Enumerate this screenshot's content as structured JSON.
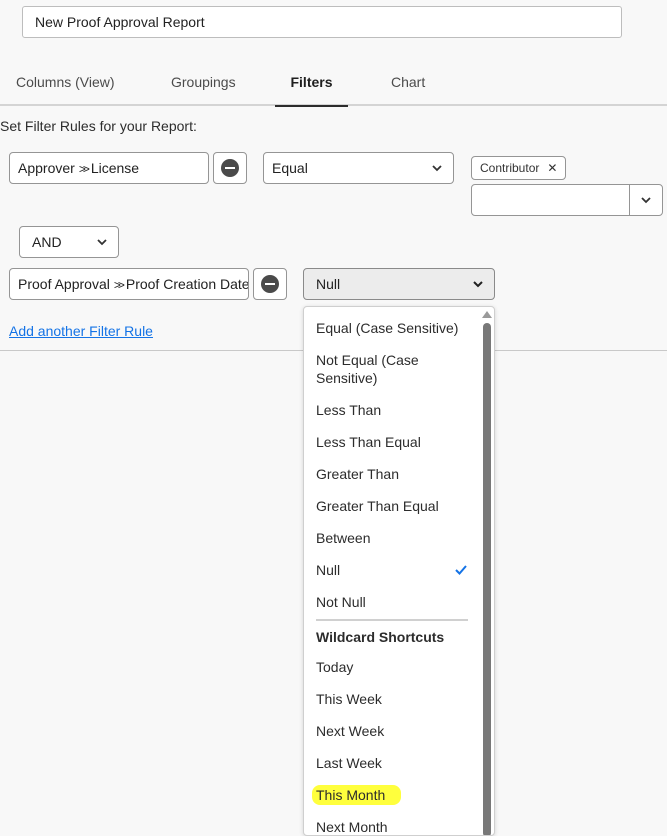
{
  "report_name": "New Proof Approval Report",
  "tabs": [
    "Columns (View)",
    "Groupings",
    "Filters",
    "Chart"
  ],
  "active_tab": "Filters",
  "filter_section_label": "Set Filter Rules for your Report:",
  "rule1": {
    "field_left": "Approver",
    "field_right": "License",
    "operator": "Equal",
    "tag": "Contributor"
  },
  "connector": "AND",
  "rule2": {
    "field_left": "Proof Approval",
    "field_right": "Proof Creation Date",
    "operator": "Null"
  },
  "add_rule_label": "Add another Filter Rule",
  "dropdown": {
    "items": [
      "Equal (Case Sensitive)",
      "Not Equal (Case Sensitive)",
      "Less Than",
      "Less Than Equal",
      "Greater Than",
      "Greater Than Equal",
      "Between",
      "Null",
      "Not Null"
    ],
    "selected": "Null",
    "section_heading": "Wildcard Shortcuts",
    "wildcards": [
      "Today",
      "This Week",
      "Next Week",
      "Last Week",
      "This Month",
      "Next Month"
    ],
    "highlighted": "This Month"
  },
  "colors": {
    "accent": "#1473e6",
    "highlight": "#ffff3d",
    "check": "#1473e6"
  }
}
